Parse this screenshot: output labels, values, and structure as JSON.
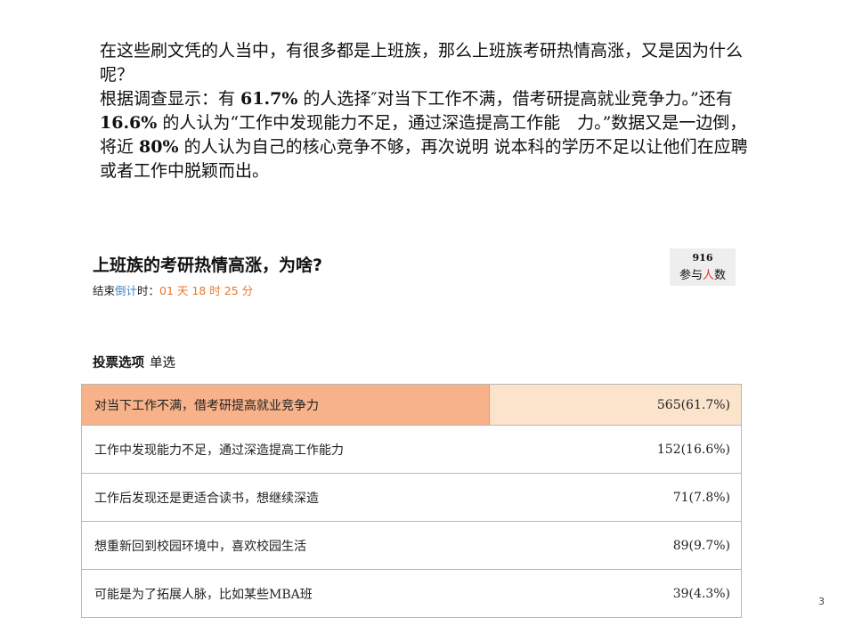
{
  "intro": {
    "p1": "在这些刷文凭的人当中，有很多都是上班族，那么上班族考研热情高涨，又是因为什么呢？",
    "p2_a": "根据调查显示：有 ",
    "p2_b": "61.7%",
    "p2_c": " 的人选择″对当下工作不满，借考研提高就业竞争力。”还有 ",
    "p2_d": "16.6%",
    "p2_e": " 的人认为“工作中发现能力不足，通过深造提高工作能　力。”数据又是一边倒，将近 ",
    "p2_f": "80%",
    "p2_g": " 的人认为自己的核心竞争不够，再次说明 说本科的学历不足以让他们在应聘或者工作中脱颖而出。"
  },
  "poll": {
    "title": "上班族的考研热情高涨，为啥?",
    "countdown_prefix": "结束",
    "countdown_blue": "倒计",
    "countdown_mid": "时：",
    "countdown_value": "01 天 18 时 25 分",
    "participants_count": "916",
    "participants_label_a": "参与",
    "participants_label_b": "人",
    "participants_label_c": "数",
    "vote_label": "投票选项",
    "vote_type": "单选",
    "options": [
      {
        "label": "对当下工作不满，借考研提高就业竞争力",
        "value": "565(61.7%)",
        "share": 0.617
      },
      {
        "label": "工作中发现能力不足，通过深造提高工作能力",
        "value": "152(16.6%)",
        "share": 0.166
      },
      {
        "label": "工作后发现还是更适合读书，想继续深造",
        "value": "71(7.8%)",
        "share": 0.078
      },
      {
        "label": "想重新回到校园环境中，喜欢校园生活",
        "value": "89(9.7%)",
        "share": 0.097
      },
      {
        "label": "可能是为了拓展人脉，比如某些MBA班",
        "value": "39(4.3%)",
        "share": 0.043
      }
    ]
  },
  "page_number": "3",
  "colors": {
    "highlight_segment": "#f8b28a",
    "highlight_fill": "#fbe3cc",
    "accent_blue": "#3a86c8",
    "accent_orange": "#e8762a",
    "accent_red": "#e03a2a"
  }
}
